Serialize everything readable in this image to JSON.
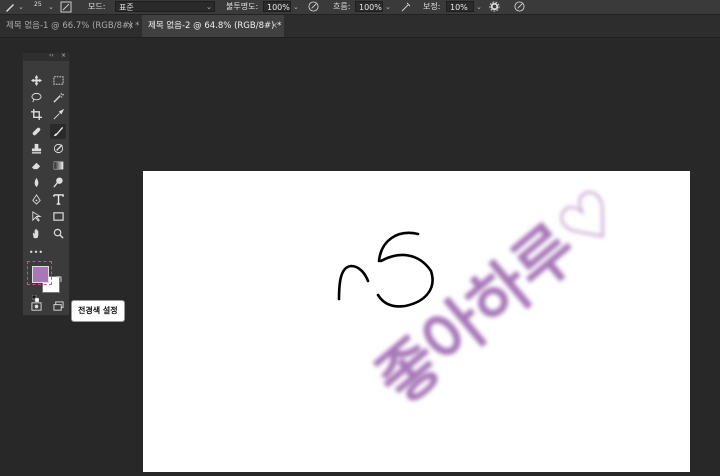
{
  "options_bar": {
    "brush_size": "25",
    "mode_label": "모드:",
    "mode_value": "표준",
    "opacity_label": "불투명도:",
    "opacity_value": "100%",
    "flow_label": "흐름:",
    "flow_value": "100%",
    "smoothing_label": "보정:",
    "smoothing_value": "10%"
  },
  "tabs": [
    {
      "label": "제목 없음-1 @ 66.7% (RGB/8#) *",
      "close": "×",
      "active": false
    },
    {
      "label": "제목 없음-2 @ 64.8% (RGB/8#) *",
      "close": "×",
      "active": true
    }
  ],
  "tools_panel": {
    "collapse": "‹‹",
    "close": "×",
    "more": "•••"
  },
  "colors": {
    "foreground": "#a777b8",
    "background": "#ffffff",
    "accent_selection": "#e040a0"
  },
  "tooltip": {
    "text": "전경색 설정"
  },
  "canvas": {
    "painted_text": "좋아하루♡"
  }
}
